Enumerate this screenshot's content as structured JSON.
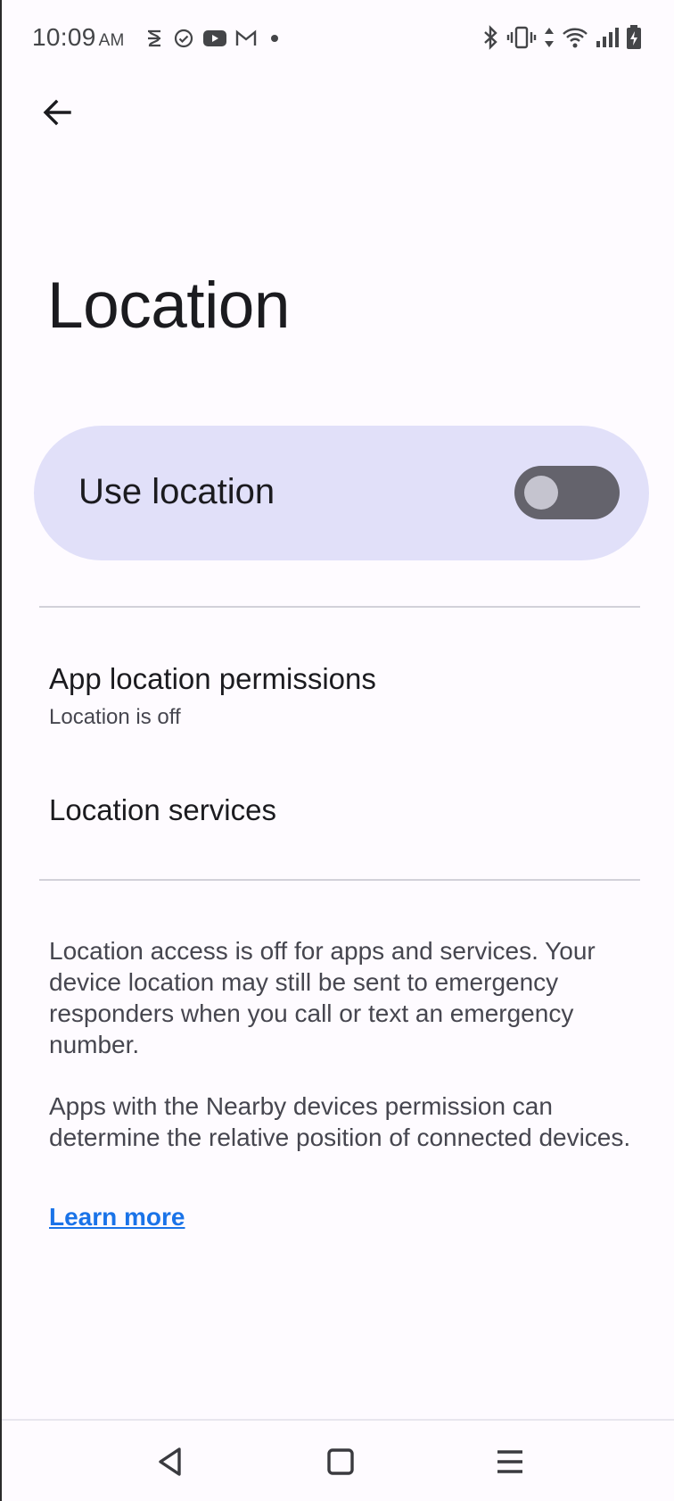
{
  "status_bar": {
    "time": "10:09",
    "ampm": "AM",
    "notification_icons": [
      "sync-alert-icon",
      "check-circle-icon",
      "youtube-icon",
      "gmail-icon",
      "dot-icon"
    ],
    "system_icons": [
      "bluetooth-icon",
      "vibrate-icon",
      "data-arrows-icon",
      "wifi-icon",
      "cell-signal-icon",
      "battery-charging-icon"
    ]
  },
  "header": {
    "title": "Location"
  },
  "main_switch": {
    "label": "Use location",
    "checked": false
  },
  "preferences": [
    {
      "title": "App location permissions",
      "summary": "Location is off"
    },
    {
      "title": "Location services",
      "summary": ""
    }
  ],
  "footer": {
    "paragraph_1": "Location access is off for apps and services. Your device location may still be sent to emergency responders when you call or text an emergency number.",
    "paragraph_2": "Apps with the Nearby devices permission can determine the relative position of connected devices.",
    "learn_more": "Learn more"
  },
  "colors": {
    "background": "#fefbff",
    "switch_bar": "#e1e0f9",
    "toggle_track_off": "#64636c",
    "toggle_thumb_off": "#c5c4cf",
    "link": "#1a73e8"
  }
}
